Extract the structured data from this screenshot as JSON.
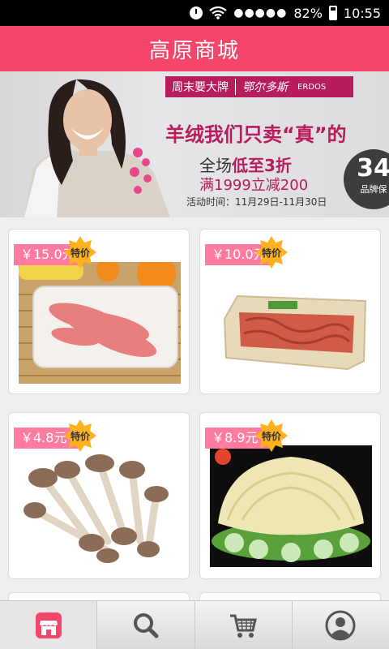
{
  "status_bar": {
    "signal": "●●●●●",
    "battery": "82%",
    "time": "10:55",
    "icons": [
      "alarm-clock-icon",
      "wifi-icon",
      "battery-icon"
    ]
  },
  "header": {
    "title": "高原商城"
  },
  "banner": {
    "brand_tag": "周末要大牌",
    "brand_name": "鄂尔多斯",
    "brand_en": "ERDOS",
    "headline": "羊绒我们只卖“真”的",
    "sale_line1_prefix": "全场",
    "sale_line1_highlight": "低至3折",
    "sale_line2": "满1999立减200",
    "dates": "活动时间：11月29日-11月30日",
    "circle_number": "34",
    "circle_text": "品牌保"
  },
  "products": [
    {
      "price": "￥15.0元",
      "badge": "特价",
      "image": "pork-strips-tray"
    },
    {
      "price": "￥10.0元",
      "badge": "特价",
      "image": "minced-meat-tray"
    },
    {
      "price": "￥4.8元",
      "badge": "特价",
      "image": "mushrooms"
    },
    {
      "price": "￥8.9元",
      "badge": "特价",
      "image": "abalone-slices-dish"
    }
  ],
  "bottom_nav": [
    {
      "id": "store",
      "icon": "storefront-icon",
      "active": true
    },
    {
      "id": "search",
      "icon": "search-icon",
      "active": false
    },
    {
      "id": "cart",
      "icon": "shopping-cart-icon",
      "active": false
    },
    {
      "id": "profile",
      "icon": "user-profile-icon",
      "active": false
    }
  ],
  "colors": {
    "accent": "#f5456b",
    "price_tag": "#ff7ba0",
    "badge": "#ffb21e",
    "banner_brand": "#b71c5c"
  }
}
